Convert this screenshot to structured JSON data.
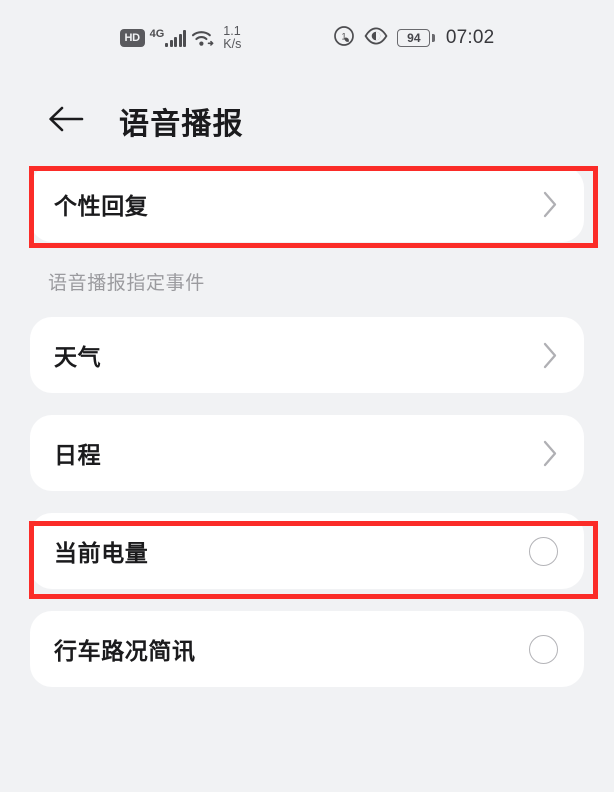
{
  "status_bar": {
    "hd_badge": "HD",
    "network_type": "4G",
    "signal_icon": "signal-bars-icon",
    "wifi_icon": "wifi-icon",
    "data_speed_value": "1.1",
    "data_speed_unit": "K/s",
    "dnd_icon": "do-not-disturb-icon",
    "eye_comfort_icon": "eye-comfort-icon",
    "battery_percent": "94",
    "battery_icon": "battery-icon",
    "clock": "07:02"
  },
  "header": {
    "back_icon": "back-arrow-icon",
    "title": "语音播报"
  },
  "list": {
    "top_item": {
      "label": "个性回复",
      "accessory": "chevron-right-icon",
      "highlighted": true
    },
    "section_label": "语音播报指定事件",
    "items": [
      {
        "label": "天气",
        "accessory": "chevron",
        "highlighted": false,
        "checked": false
      },
      {
        "label": "日程",
        "accessory": "chevron",
        "highlighted": false,
        "checked": false
      },
      {
        "label": "当前电量",
        "accessory": "radio",
        "highlighted": true,
        "checked": false
      },
      {
        "label": "行车路况简讯",
        "accessory": "radio",
        "highlighted": false,
        "checked": false
      }
    ]
  },
  "annotations": {
    "color": "#fb2c28",
    "count": 2
  },
  "theme": {
    "background": "#f1f2f4",
    "card_background": "#ffffff",
    "primary_text": "#1b1b1d",
    "secondary_text": "#9b9b9f",
    "icon_gray": "#b4b4b8"
  }
}
